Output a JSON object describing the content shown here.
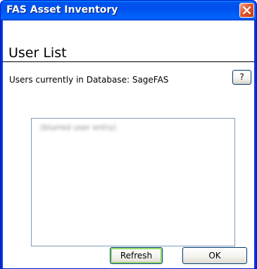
{
  "window": {
    "title": "FAS Asset Inventory"
  },
  "dialog": {
    "heading": "User List",
    "users_label": "Users currently in Database: SageFAS",
    "help_label": "?",
    "users": [
      "(blurred user entry)"
    ],
    "refresh_label": "Refresh",
    "ok_label": "OK"
  },
  "colors": {
    "titlebar": "#0054e3",
    "close_button": "#e0562f",
    "default_button_highlight": "#7ed350",
    "listbox_border": "#7f9db9"
  },
  "icons": {
    "close": "close-icon"
  }
}
